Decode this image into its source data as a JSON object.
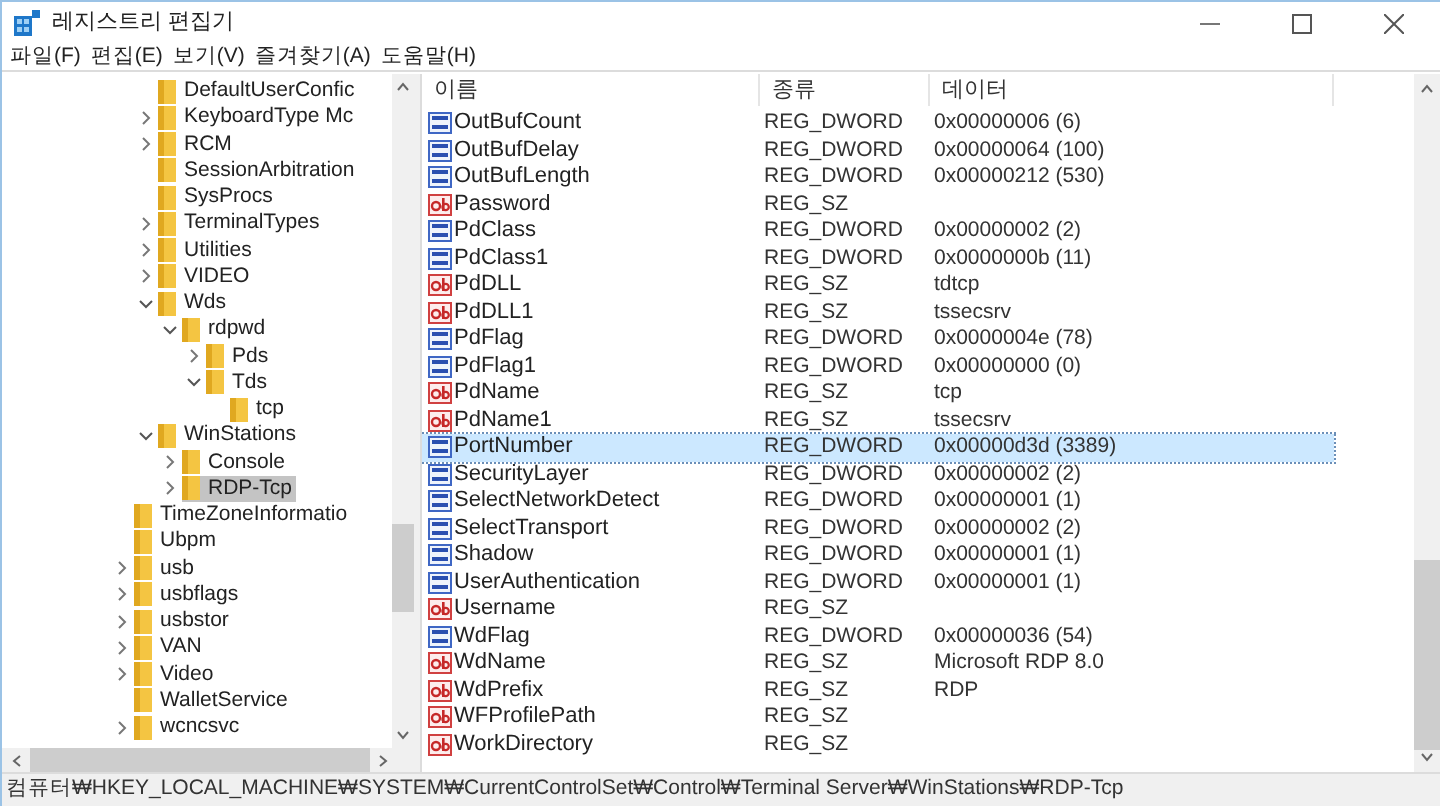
{
  "window": {
    "title": "레지스트리 편집기"
  },
  "menu": [
    "파일(F)",
    "편집(E)",
    "보기(V)",
    "즐겨찾기(A)",
    "도움말(H)"
  ],
  "tree": [
    {
      "children": [
        {
          "label": "DefaultUserConfic",
          "expandable": false,
          "selected": false
        },
        {
          "label": "KeyboardType Mc",
          "expandable": true,
          "expanded": false,
          "selected": false
        },
        {
          "label": "RCM",
          "expandable": true,
          "expanded": false,
          "selected": false
        },
        {
          "label": "SessionArbitration",
          "expandable": false,
          "selected": false
        },
        {
          "label": "SysProcs",
          "expandable": false,
          "selected": false
        },
        {
          "label": "TerminalTypes",
          "expandable": true,
          "expanded": false,
          "selected": false
        },
        {
          "label": "Utilities",
          "expandable": true,
          "expanded": false,
          "selected": false
        },
        {
          "label": "VIDEO",
          "expandable": true,
          "expanded": false,
          "selected": false
        },
        {
          "label": "Wds",
          "expandable": true,
          "expanded": true,
          "selected": false,
          "children": [
            {
              "label": "rdpwd",
              "expandable": true,
              "expanded": true,
              "selected": false,
              "children": [
                {
                  "label": "Pds",
                  "expandable": true,
                  "expanded": false,
                  "selected": false
                },
                {
                  "label": "Tds",
                  "expandable": true,
                  "expanded": true,
                  "selected": false,
                  "children": [
                    {
                      "label": "tcp",
                      "expandable": false,
                      "selected": false
                    }
                  ]
                }
              ]
            }
          ]
        },
        {
          "label": "WinStations",
          "expandable": true,
          "expanded": true,
          "selected": false,
          "children": [
            {
              "label": "Console",
              "expandable": true,
              "expanded": false,
              "selected": false
            },
            {
              "label": "RDP-Tcp",
              "expandable": true,
              "expanded": false,
              "selected": true
            }
          ]
        }
      ]
    },
    {
      "label": "TimeZoneInformatio",
      "expandable": false,
      "selected": false
    },
    {
      "label": "Ubpm",
      "expandable": false,
      "selected": false
    },
    {
      "label": "usb",
      "expandable": true,
      "expanded": false,
      "selected": false
    },
    {
      "label": "usbflags",
      "expandable": true,
      "expanded": false,
      "selected": false
    },
    {
      "label": "usbstor",
      "expandable": true,
      "expanded": false,
      "selected": false
    },
    {
      "label": "VAN",
      "expandable": true,
      "expanded": false,
      "selected": false
    },
    {
      "label": "Video",
      "expandable": true,
      "expanded": false,
      "selected": false
    },
    {
      "label": "WalletService",
      "expandable": false,
      "selected": false
    },
    {
      "label": "wcncsvc",
      "expandable": true,
      "expanded": false,
      "selected": false
    }
  ],
  "table": {
    "columns": [
      "이름",
      "종류",
      "데이터"
    ],
    "rows": [
      {
        "kind": "dword",
        "name": "OutBufCount",
        "type": "REG_DWORD",
        "data": "0x00000006 (6)",
        "selected": false
      },
      {
        "kind": "dword",
        "name": "OutBufDelay",
        "type": "REG_DWORD",
        "data": "0x00000064 (100)",
        "selected": false
      },
      {
        "kind": "dword",
        "name": "OutBufLength",
        "type": "REG_DWORD",
        "data": "0x00000212 (530)",
        "selected": false
      },
      {
        "kind": "sz",
        "name": "Password",
        "type": "REG_SZ",
        "selected": false
      },
      {
        "kind": "dword",
        "name": "PdClass",
        "type": "REG_DWORD",
        "data": "0x00000002 (2)",
        "selected": false
      },
      {
        "kind": "dword",
        "name": "PdClass1",
        "type": "REG_DWORD",
        "data": "0x0000000b (11)",
        "selected": false
      },
      {
        "kind": "sz",
        "name": "PdDLL",
        "type": "REG_SZ",
        "data": "tdtcp",
        "selected": false
      },
      {
        "kind": "sz",
        "name": "PdDLL1",
        "type": "REG_SZ",
        "data": "tssecsrv",
        "selected": false
      },
      {
        "kind": "dword",
        "name": "PdFlag",
        "type": "REG_DWORD",
        "data": "0x0000004e (78)",
        "selected": false
      },
      {
        "kind": "dword",
        "name": "PdFlag1",
        "type": "REG_DWORD",
        "data": "0x00000000 (0)",
        "selected": false
      },
      {
        "kind": "sz",
        "name": "PdName",
        "type": "REG_SZ",
        "data": "tcp",
        "selected": false
      },
      {
        "kind": "sz",
        "name": "PdName1",
        "type": "REG_SZ",
        "data": "tssecsrv",
        "selected": false
      },
      {
        "kind": "dword",
        "name": "PortNumber",
        "type": "REG_DWORD",
        "data": "0x00000d3d (3389)",
        "selected": true
      },
      {
        "kind": "dword",
        "name": "SecurityLayer",
        "type": "REG_DWORD",
        "data": "0x00000002 (2)",
        "selected": false
      },
      {
        "kind": "dword",
        "name": "SelectNetworkDetect",
        "type": "REG_DWORD",
        "data": "0x00000001 (1)",
        "selected": false
      },
      {
        "kind": "dword",
        "name": "SelectTransport",
        "type": "REG_DWORD",
        "data": "0x00000002 (2)",
        "selected": false
      },
      {
        "kind": "dword",
        "name": "Shadow",
        "type": "REG_DWORD",
        "data": "0x00000001 (1)",
        "selected": false
      },
      {
        "kind": "dword",
        "name": "UserAuthentication",
        "type": "REG_DWORD",
        "data": "0x00000001 (1)",
        "selected": false
      },
      {
        "kind": "sz",
        "name": "Username",
        "type": "REG_SZ",
        "selected": false
      },
      {
        "kind": "dword",
        "name": "WdFlag",
        "type": "REG_DWORD",
        "data": "0x00000036 (54)",
        "selected": false
      },
      {
        "kind": "sz",
        "name": "WdName",
        "type": "REG_SZ",
        "data": "Microsoft RDP 8.0",
        "selected": false
      },
      {
        "kind": "sz",
        "name": "WdPrefix",
        "type": "REG_SZ",
        "data": "RDP",
        "selected": false
      },
      {
        "kind": "sz",
        "name": "WFProfilePath",
        "type": "REG_SZ",
        "selected": false
      },
      {
        "kind": "sz",
        "name": "WorkDirectory",
        "type": "REG_SZ",
        "selected": false
      }
    ]
  },
  "status_bar": "컴퓨터₩HKEY_LOCAL_MACHINE₩SYSTEM₩CurrentControlSet₩Control₩Terminal Server₩WinStations₩RDP-Tcp"
}
